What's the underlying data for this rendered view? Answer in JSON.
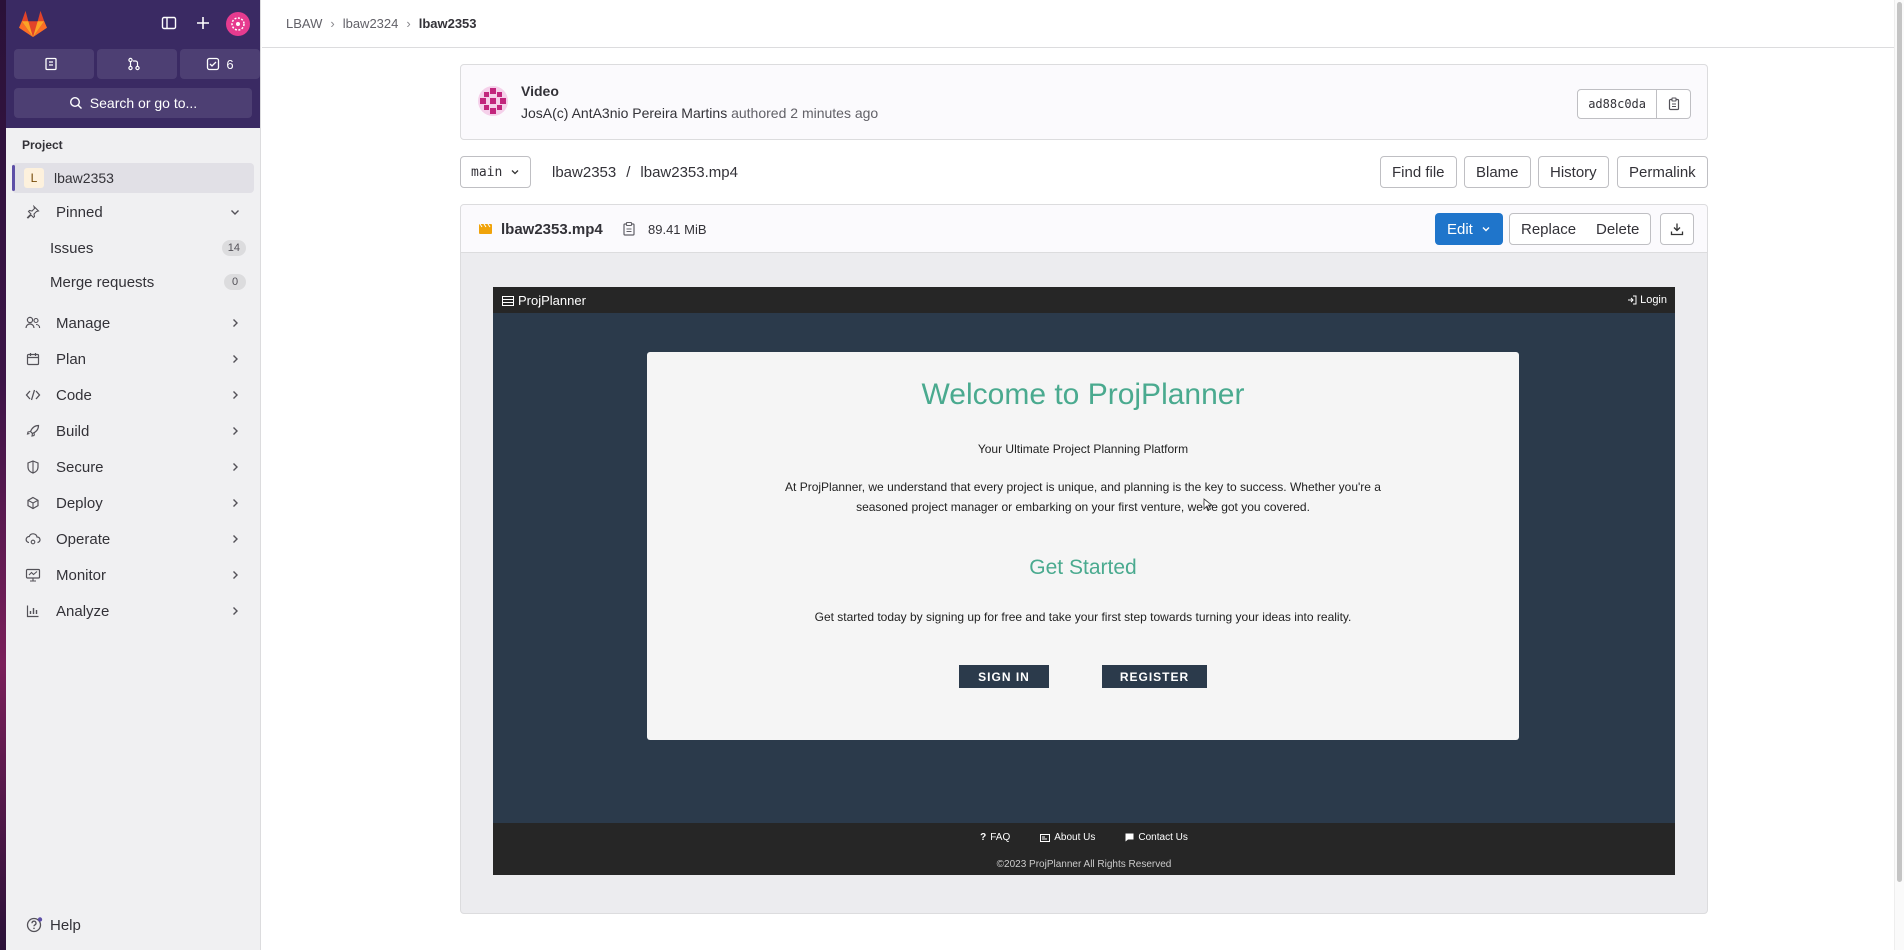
{
  "sidebar": {
    "counters": [
      {
        "icon": "issues-icon",
        "count": ""
      },
      {
        "icon": "merge-request-icon",
        "count": ""
      },
      {
        "icon": "todo-icon",
        "count": "6"
      }
    ],
    "search_label": "Search or go to...",
    "section_label": "Project",
    "project": {
      "initial": "L",
      "name": "lbaw2353"
    },
    "pinned": {
      "label": "Pinned",
      "items": [
        {
          "label": "Issues",
          "count": "14"
        },
        {
          "label": "Merge requests",
          "count": "0"
        }
      ]
    },
    "nav": [
      {
        "label": "Manage",
        "icon": "users-icon"
      },
      {
        "label": "Plan",
        "icon": "planning-icon"
      },
      {
        "label": "Code",
        "icon": "code-icon"
      },
      {
        "label": "Build",
        "icon": "rocket-icon"
      },
      {
        "label": "Secure",
        "icon": "shield-icon"
      },
      {
        "label": "Deploy",
        "icon": "deployments-icon"
      },
      {
        "label": "Operate",
        "icon": "cloud-gear-icon"
      },
      {
        "label": "Monitor",
        "icon": "monitor-icon"
      },
      {
        "label": "Analyze",
        "icon": "chart-icon"
      }
    ],
    "help_label": "Help"
  },
  "breadcrumb": [
    "LBAW",
    "lbaw2324",
    "lbaw2353"
  ],
  "commit": {
    "title": "Video",
    "author": "JosA(c) AntA3nio Pereira Martins",
    "action": "authored",
    "time": "2 minutes ago",
    "sha": "ad88c0da"
  },
  "file_nav": {
    "branch": "main",
    "path_root": "lbaw2353",
    "path_sep": "/",
    "file": "lbaw2353.mp4",
    "buttons": [
      "Find file",
      "Blame",
      "History",
      "Permalink"
    ]
  },
  "file": {
    "name": "lbaw2353.mp4",
    "size": "89.41 MiB",
    "edit_label": "Edit",
    "replace_label": "Replace",
    "delete_label": "Delete"
  },
  "video": {
    "brand": "ProjPlanner",
    "login": "Login",
    "title": "Welcome to ProjPlanner",
    "tagline": "Your Ultimate Project Planning Platform",
    "paragraph": "At ProjPlanner, we understand that every project is unique, and planning is the key to success. Whether you're a seasoned project manager or embarking on your first venture, we've got you covered.",
    "subtitle": "Get Started",
    "cta_text": "Get started today by signing up for free and take your first step towards turning your ideas into reality.",
    "sign_in": "SIGN IN",
    "register": "REGISTER",
    "footer_links": [
      "FAQ",
      "About Us",
      "Contact Us"
    ],
    "copyright": "©2023 ProjPlanner All Rights Reserved"
  },
  "colors": {
    "sidebar_top": "#3a2a63",
    "primary_button": "#1f75cb",
    "video_bg": "#2b3a4b",
    "video_accent": "#4aaa8f"
  }
}
